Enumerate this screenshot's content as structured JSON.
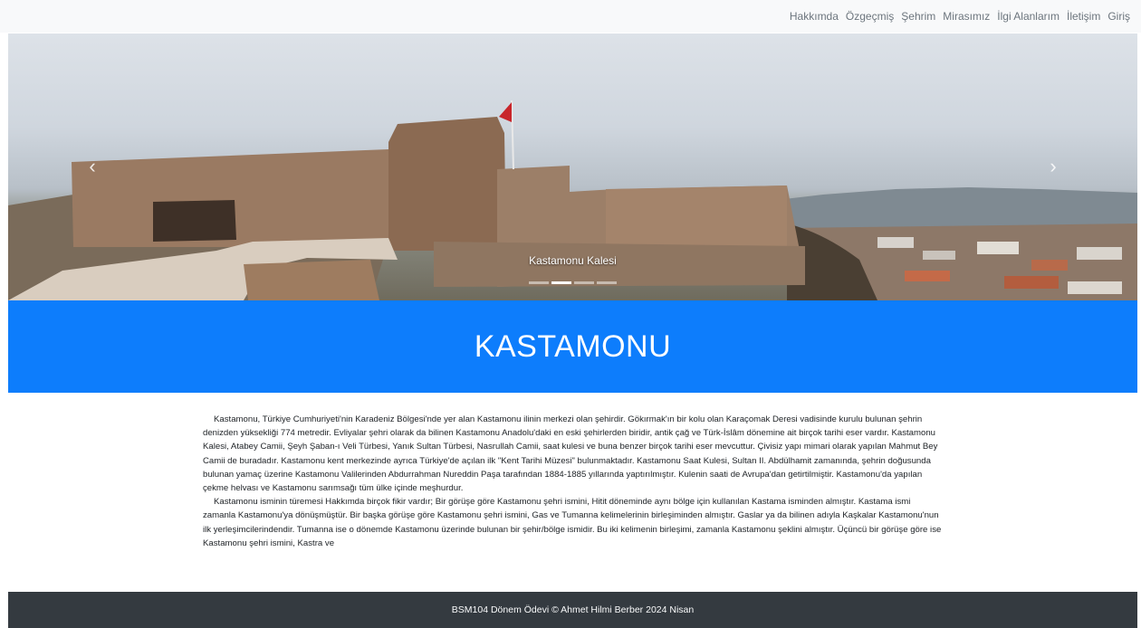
{
  "nav": {
    "items": [
      {
        "label": "Hakkımda"
      },
      {
        "label": "Özgeçmiş"
      },
      {
        "label": "Şehrim"
      },
      {
        "label": "Mirasımız"
      },
      {
        "label": "İlgi Alanlarım"
      },
      {
        "label": "İletişim"
      },
      {
        "label": "Giriş"
      }
    ]
  },
  "carousel": {
    "caption": "Kastamonu Kalesi",
    "prev_icon": "‹",
    "next_icon": "›",
    "slide_count": 4,
    "active_index": 1
  },
  "banner": {
    "title": "KASTAMONU",
    "color": "#0d7dfc"
  },
  "content": {
    "paragraph1": "Kastamonu, Türkiye Cumhuriyeti'nin Karadeniz Bölgesi'nde yer alan Kastamonu ilinin merkezi olan şehirdir. Gökırmak'ın bir kolu olan Karaçomak Deresi vadisinde kurulu bulunan şehrin denizden yüksekliği 774 metredir. Evliyalar şehri olarak da bilinen Kastamonu Anadolu'daki en eski şehirlerden biridir, antik çağ ve Türk-İslâm dönemine ait birçok tarihi eser vardır. Kastamonu Kalesi, Atabey Camii, Şeyh Şaban-ı Veli Türbesi, Yanık Sultan Türbesi, Nasrullah Camii, saat kulesi ve buna benzer birçok tarihi eser mevcuttur. Çivisiz yapı mimari olarak yapılan Mahmut Bey Camii de buradadır. Kastamonu kent merkezinde ayrıca Türkiye'de açılan ilk \"Kent Tarihi Müzesi\" bulunmaktadır. Kastamonu Saat Kulesi, Sultan II. Abdülhamit zamanında, şehrin doğusunda bulunan yamaç üzerine Kastamonu Valilerinden Abdurrahman Nureddin Paşa tarafından 1884-1885 yıllarında yaptırılmıştır. Kulenin saati de Avrupa'dan getirtilmiştir. Kastamonu'da yapılan çekme helvası ve Kastamonu sarımsağı tüm ülke içinde meşhurdur.",
    "paragraph2": "Kastamonu isminin türemesi Hakkımda birçok fikir vardır; Bir görüşe göre Kastamonu şehri ismini, Hitit döneminde aynı bölge için kullanılan Kastama isminden almıştır. Kastama ismi zamanla Kastamonu'ya dönüşmüştür. Bir başka görüşe göre Kastamonu şehri ismini, Gas ve Tumanna kelimelerinin birleşiminden almıştır. Gaslar ya da bilinen adıyla Kaşkalar Kastamonu'nun ilk yerleşimcilerindendir. Tumanna ise o dönemde Kastamonu üzerinde bulunan bir şehir/bölge ismidir. Bu iki kelimenin birleşimi, zamanla Kastamonu şeklini almıştır. Üçüncü bir görüşe göre ise Kastamonu şehri ismini, Kastra ve"
  },
  "footer": {
    "text": "BSM104 Dönem Ödevi © Ahmet Hilmi Berber 2024 Nisan"
  }
}
